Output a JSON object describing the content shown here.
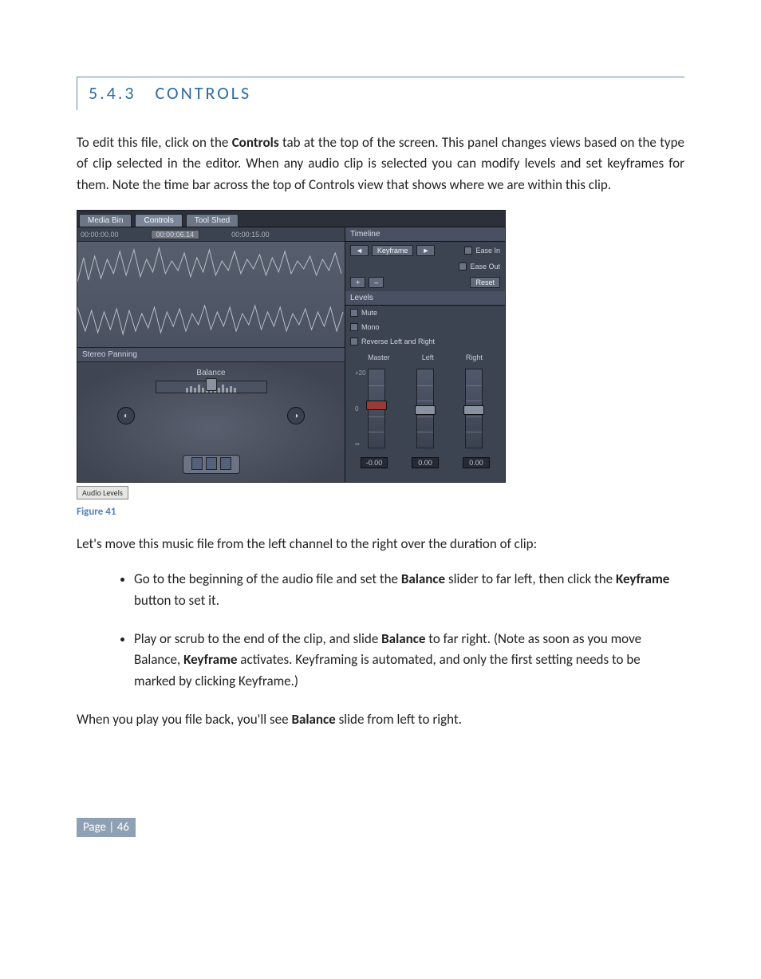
{
  "section": {
    "number": "5.4.3",
    "title": "CONTROLS"
  },
  "p1_a": "To edit this file, click on the ",
  "p1_b": "Controls",
  "p1_c": " tab at the top of the screen. This panel changes views based on the type of clip selected in the editor.  When any audio clip is selected you can modify levels and set keyframes for them. Note the time bar across the top of Controls view that shows where we are within this clip.",
  "figure_caption": "Figure 41",
  "p2": "Let's move this music file from the left channel to the right over the duration of clip:",
  "b1_a": "Go to the beginning of the audio file and set the ",
  "b1_b": "Balance",
  "b1_c": " slider to far left, then click the ",
  "b1_d": "Keyframe",
  "b1_e": " button to set it.",
  "b2_a": "Play or scrub to the end of the clip, and slide ",
  "b2_b": "Balance",
  "b2_c": " to far right. (Note as soon as you move Balance, ",
  "b2_d": "Keyframe",
  "b2_e": " activates. Keyframing is automated, and only the first setting needs to be marked by clicking Keyframe.)",
  "p3_a": " When you play you file back, you'll see ",
  "p3_b": "Balance",
  "p3_c": " slide from left to right.",
  "footer": "Page | 46",
  "ui": {
    "tabs": {
      "media_bin": "Media Bin",
      "controls": "Controls",
      "tool_shed": "Tool Shed"
    },
    "ruler": {
      "t0": "00:00:00.00",
      "marker": "00:00:06.14",
      "t1": "00:00:15.00"
    },
    "stereo_panning": "Stereo Panning",
    "balance": "Balance",
    "timeline": {
      "header": "Timeline",
      "keyframe": "Keyframe",
      "prev": "◄",
      "next": "►",
      "ease_in": "Ease In",
      "ease_out": "Ease Out",
      "plus": "+",
      "minus": "–",
      "reset": "Reset"
    },
    "levels": {
      "header": "Levels",
      "mute": "Mute",
      "mono": "Mono",
      "reverse": "Reverse Left and Right"
    },
    "mixer": {
      "master": "Master",
      "left": "Left",
      "right": "Right",
      "plus20": "+20",
      "zero": "0",
      "inf": "∞",
      "val_master": "-0.00",
      "val_left": "0.00",
      "val_right": "0.00"
    },
    "aux_tab": "Audio Levels"
  }
}
